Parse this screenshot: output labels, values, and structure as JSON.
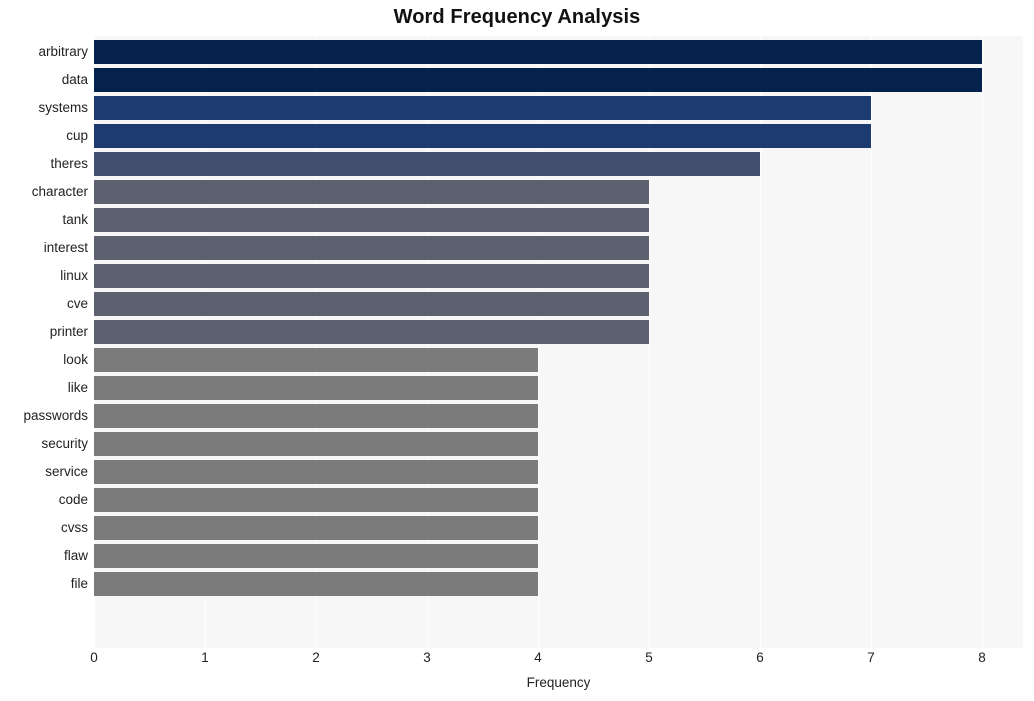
{
  "chart_data": {
    "type": "bar",
    "orientation": "horizontal",
    "title": "Word Frequency Analysis",
    "xlabel": "Frequency",
    "ylabel": "",
    "xlim": [
      0,
      8
    ],
    "xticks": [
      "0",
      "1",
      "2",
      "3",
      "4",
      "5",
      "6",
      "7",
      "8"
    ],
    "grid": true,
    "legend": "none",
    "categories": [
      "arbitrary",
      "data",
      "systems",
      "cup",
      "theres",
      "character",
      "tank",
      "interest",
      "linux",
      "cve",
      "printer",
      "look",
      "like",
      "passwords",
      "security",
      "service",
      "code",
      "cvss",
      "flaw",
      "file"
    ],
    "values": [
      8,
      8,
      7,
      7,
      6,
      5,
      5,
      5,
      5,
      5,
      5,
      4,
      4,
      4,
      4,
      4,
      4,
      4,
      4,
      4
    ],
    "bar_colors": [
      "#04224c",
      "#04224c",
      "#1d3b6f",
      "#1d3b6f",
      "#434f6e",
      "#5c6170",
      "#5c6170",
      "#5c6170",
      "#5c6170",
      "#5c6170",
      "#5c6170",
      "#7b7b7b",
      "#7b7b7b",
      "#7b7b7b",
      "#7b7b7b",
      "#7b7b7b",
      "#7b7b7b",
      "#7b7b7b",
      "#7b7b7b",
      "#7b7b7b"
    ],
    "plot_background": "#f7f7f7",
    "gridline_color": "#ffffff",
    "figure_background": "#ffffff"
  }
}
